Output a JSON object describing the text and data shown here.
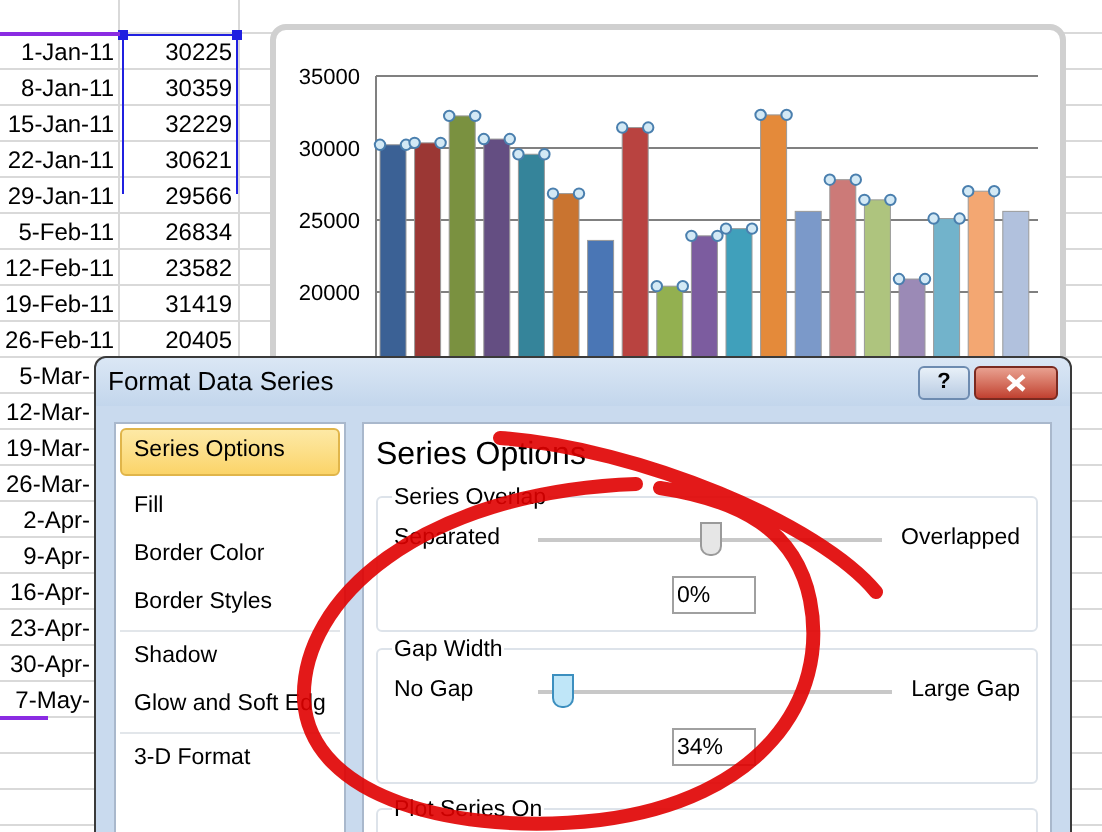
{
  "spreadsheet": {
    "rows": [
      {
        "date": "1-Jan-11",
        "value": "30225"
      },
      {
        "date": "8-Jan-11",
        "value": "30359"
      },
      {
        "date": "15-Jan-11",
        "value": "32229"
      },
      {
        "date": "22-Jan-11",
        "value": "30621"
      },
      {
        "date": "29-Jan-11",
        "value": "29566"
      },
      {
        "date": "5-Feb-11",
        "value": "26834"
      },
      {
        "date": "12-Feb-11",
        "value": "23582"
      },
      {
        "date": "19-Feb-11",
        "value": "31419"
      },
      {
        "date": "26-Feb-11",
        "value": "20405"
      },
      {
        "date": "5-Mar-"
      },
      {
        "date": "12-Mar-"
      },
      {
        "date": "19-Mar-"
      },
      {
        "date": "26-Mar-"
      },
      {
        "date": "2-Apr-"
      },
      {
        "date": "9-Apr-"
      },
      {
        "date": "16-Apr-"
      },
      {
        "date": "23-Apr-"
      },
      {
        "date": "30-Apr-"
      },
      {
        "date": "7-May-"
      }
    ]
  },
  "chart": {
    "selected_points": [
      true,
      true,
      true,
      true,
      true,
      true,
      false,
      true,
      true,
      true,
      true,
      true,
      false,
      true,
      true,
      true,
      true,
      true,
      false
    ],
    "chart_data": {
      "type": "bar",
      "values": [
        30225,
        30359,
        32229,
        30621,
        29566,
        26834,
        23582,
        31419,
        20405,
        23900,
        24400,
        32300,
        25600,
        27800,
        26400,
        20900,
        25100,
        27000,
        25600
      ],
      "ylim": [
        15000,
        35000
      ],
      "grid": true,
      "yticks": [
        20000,
        25000,
        30000,
        35000
      ]
    }
  },
  "dialog": {
    "title": "Format Data Series",
    "help": "?",
    "categories": [
      {
        "label": "Series Options",
        "selected": true
      },
      {
        "label": "Fill",
        "selected": false
      },
      {
        "label": "Border Color",
        "selected": false
      },
      {
        "label": "Border Styles",
        "selected": false
      },
      {
        "label": "Shadow",
        "selected": false
      },
      {
        "label": "Glow and Soft Edg",
        "selected": false
      },
      {
        "label": "3-D Format",
        "selected": false
      }
    ],
    "heading": "Series Options",
    "groups": [
      {
        "kind": "slider",
        "title": "Series Overlap",
        "left_label": "Separated",
        "right_label": "Overlapped",
        "level": 0.5,
        "value": "0%"
      },
      {
        "kind": "slider",
        "title": "Gap Width",
        "left_label": "No Gap",
        "right_label": "Large Gap",
        "level": 0.068,
        "value": "34%"
      },
      {
        "kind": "partial",
        "title": "Plot Series On"
      }
    ]
  }
}
